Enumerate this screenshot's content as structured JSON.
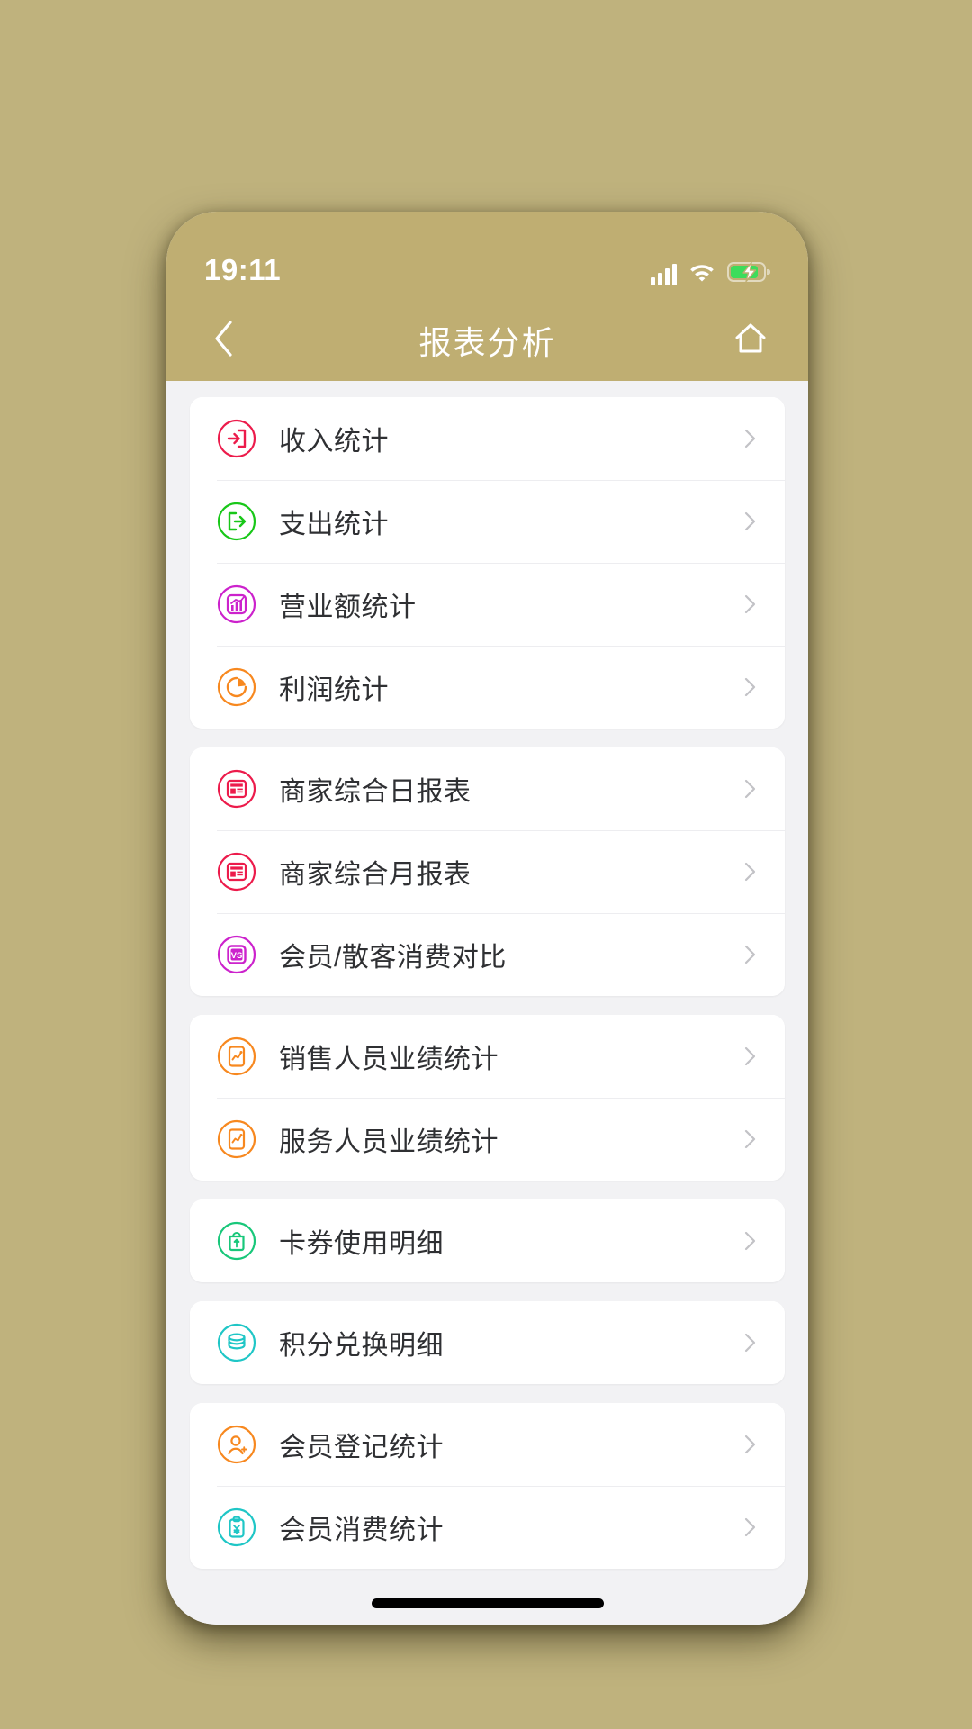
{
  "theme": {
    "page_background": "#bfb27d",
    "header_background": "#bfae72",
    "screen_background": "#f2f2f4",
    "card_background": "#ffffff",
    "label_color": "#2f3033",
    "chevron_color": "#c2c2c6"
  },
  "status_bar": {
    "time": "19:11",
    "signal_icon": "signal-bars-icon",
    "wifi_icon": "wifi-icon",
    "battery_icon": "battery-charging-icon",
    "battery_color": "#3ddc5b"
  },
  "nav": {
    "back_icon": "chevron-left-icon",
    "title": "报表分析",
    "home_icon": "home-icon"
  },
  "groups": [
    {
      "id": "group-finance",
      "items": [
        {
          "label": "收入统计",
          "icon": "income-login-arrow-icon",
          "color": "#ec1b4b"
        },
        {
          "label": "支出统计",
          "icon": "expense-logout-arrow-icon",
          "color": "#18c718"
        },
        {
          "label": "营业额统计",
          "icon": "turnover-bar-chart-icon",
          "color": "#cc22cc"
        },
        {
          "label": "利润统计",
          "icon": "profit-pie-chart-icon",
          "color": "#f7881f"
        }
      ]
    },
    {
      "id": "group-merchant-reports",
      "items": [
        {
          "label": "商家综合日报表",
          "icon": "daily-report-icon",
          "color": "#ec1b4b"
        },
        {
          "label": "商家综合月报表",
          "icon": "monthly-report-icon",
          "color": "#ec1b4b"
        },
        {
          "label": "会员/散客消费对比",
          "icon": "member-vs-guest-icon",
          "color": "#cc22cc"
        }
      ]
    },
    {
      "id": "group-staff-performance",
      "items": [
        {
          "label": "销售人员业绩统计",
          "icon": "sales-performance-icon",
          "color": "#f7881f"
        },
        {
          "label": "服务人员业绩统计",
          "icon": "service-performance-icon",
          "color": "#f7881f"
        }
      ]
    },
    {
      "id": "group-coupon",
      "items": [
        {
          "label": "卡券使用明细",
          "icon": "coupon-gift-bag-icon",
          "color": "#18c77a"
        }
      ]
    },
    {
      "id": "group-points",
      "items": [
        {
          "label": "积分兑换明细",
          "icon": "points-coins-icon",
          "color": "#1fc6c6"
        }
      ]
    },
    {
      "id": "group-member",
      "items": [
        {
          "label": "会员登记统计",
          "icon": "member-register-user-icon",
          "color": "#f7881f"
        },
        {
          "label": "会员消费统计",
          "icon": "member-spend-clipboard-icon",
          "color": "#1fc6c6"
        }
      ]
    }
  ],
  "home_indicator": "home-indicator-bar"
}
